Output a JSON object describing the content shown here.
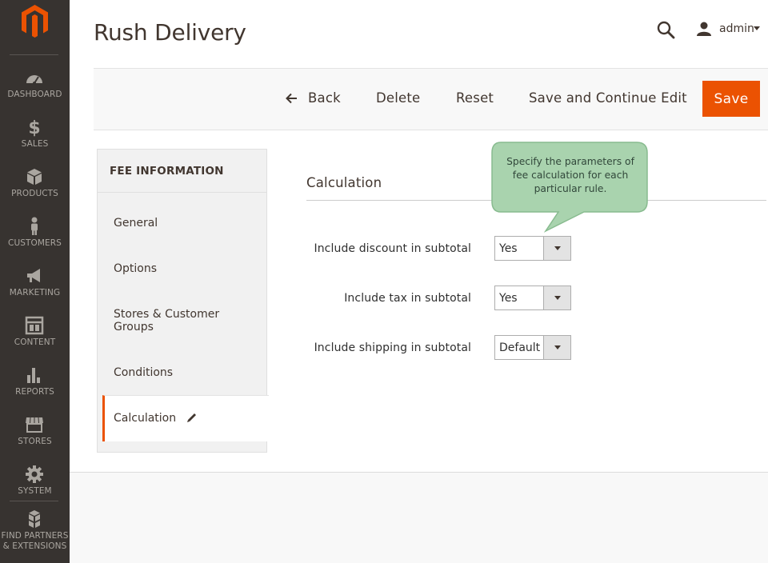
{
  "app": {
    "page_title": "Rush Delivery",
    "user": {
      "name": "admin"
    }
  },
  "sidebar": {
    "items": [
      {
        "label": "DASHBOARD",
        "icon": "dashboard-icon"
      },
      {
        "label": "SALES",
        "icon": "dollar-icon"
      },
      {
        "label": "PRODUCTS",
        "icon": "box-icon"
      },
      {
        "label": "CUSTOMERS",
        "icon": "person-icon"
      },
      {
        "label": "MARKETING",
        "icon": "megaphone-icon"
      },
      {
        "label": "CONTENT",
        "icon": "layout-icon"
      },
      {
        "label": "REPORTS",
        "icon": "bar-chart-icon"
      },
      {
        "label": "STORES",
        "icon": "storefront-icon"
      },
      {
        "label": "SYSTEM",
        "icon": "gear-icon"
      }
    ],
    "partners": {
      "line1": "FIND PARTNERS",
      "line2": "& EXTENSIONS",
      "icon": "blocks-icon"
    }
  },
  "toolbar": {
    "back_label": "Back",
    "delete_label": "Delete",
    "reset_label": "Reset",
    "save_continue_label": "Save and Continue Edit",
    "save_label": "Save"
  },
  "tabs": {
    "title": "FEE INFORMATION",
    "items": [
      {
        "label": "General"
      },
      {
        "label": "Options"
      },
      {
        "label": "Stores & Customer Groups"
      },
      {
        "label": "Conditions"
      },
      {
        "label": "Calculation",
        "active": true
      }
    ]
  },
  "main": {
    "section_title": "Calculation",
    "tooltip": "Specify the parameters of fee calculation for each particular rule.",
    "fields": [
      {
        "label": "Include discount in subtotal",
        "value": "Yes"
      },
      {
        "label": "Include tax in subtotal",
        "value": "Yes"
      },
      {
        "label": "Include shipping in subtotal",
        "value": "Default"
      }
    ]
  },
  "colors": {
    "sidebar_bg": "#373330",
    "accent": "#eb5202",
    "tooltip_bg": "#a9d3ae",
    "tooltip_border": "#88bb8f"
  }
}
